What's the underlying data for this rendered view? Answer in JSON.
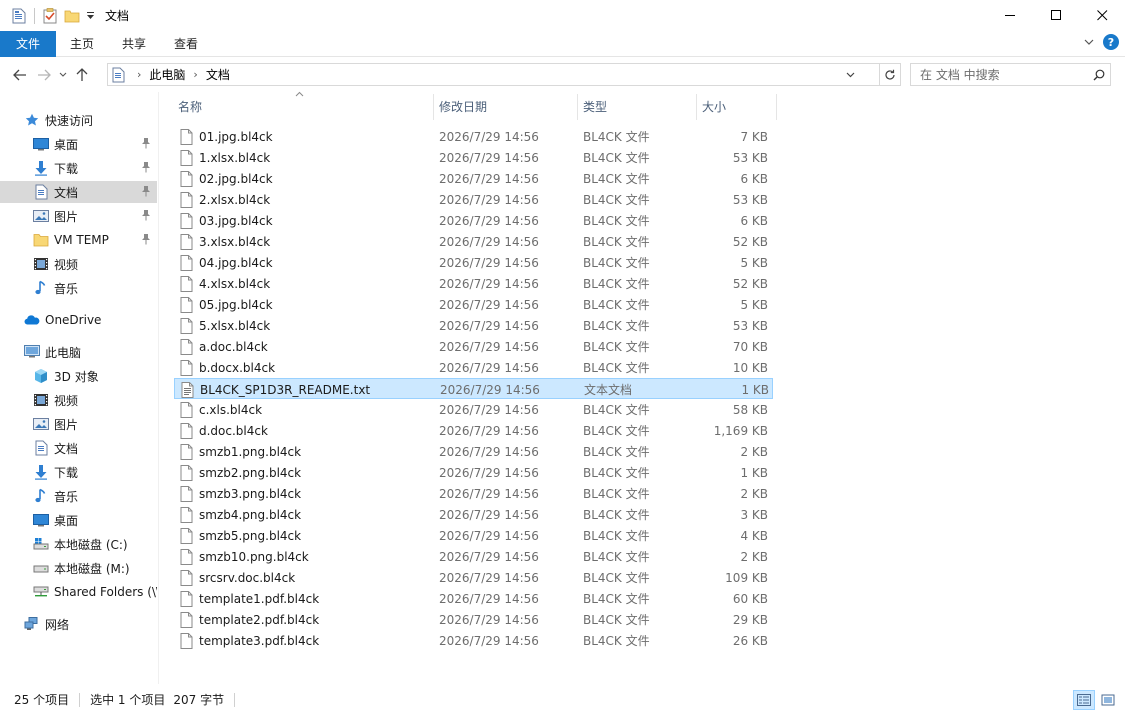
{
  "window": {
    "title": "文档"
  },
  "ribbon": {
    "tabs": [
      "文件",
      "主页",
      "共享",
      "查看"
    ]
  },
  "address": {
    "crumbs": [
      "此电脑",
      "文档"
    ]
  },
  "search": {
    "placeholder": "在 文档 中搜索"
  },
  "sidebar": {
    "quick_access": "快速访问",
    "qa_items": [
      {
        "label": "桌面",
        "icon": "desktop-icon"
      },
      {
        "label": "下载",
        "icon": "download-icon"
      },
      {
        "label": "文档",
        "icon": "document-icon"
      },
      {
        "label": "图片",
        "icon": "pictures-icon"
      },
      {
        "label": "VM TEMP",
        "icon": "folder-icon"
      },
      {
        "label": "视频",
        "icon": "video-icon"
      },
      {
        "label": "音乐",
        "icon": "music-icon"
      }
    ],
    "onedrive": "OneDrive",
    "this_pc": "此电脑",
    "pc_items": [
      {
        "label": "3D 对象",
        "icon": "3d-objects-icon"
      },
      {
        "label": "视频",
        "icon": "video-icon"
      },
      {
        "label": "图片",
        "icon": "pictures-icon"
      },
      {
        "label": "文档",
        "icon": "document-icon"
      },
      {
        "label": "下载",
        "icon": "download-icon"
      },
      {
        "label": "音乐",
        "icon": "music-icon"
      },
      {
        "label": "桌面",
        "icon": "desktop-icon"
      },
      {
        "label": "本地磁盘 (C:)",
        "icon": "drive-c-icon"
      },
      {
        "label": "本地磁盘 (M:)",
        "icon": "drive-icon"
      },
      {
        "label": "Shared Folders (\\\\",
        "icon": "network-drive-icon"
      }
    ],
    "network": "网络"
  },
  "columns": {
    "name": "名称",
    "date": "修改日期",
    "type": "类型",
    "size": "大小"
  },
  "files": [
    {
      "name": "01.jpg.bl4ck",
      "date": "2026/7/29 14:56",
      "type": "BL4CK 文件",
      "size": "7 KB"
    },
    {
      "name": "1.xlsx.bl4ck",
      "date": "2026/7/29 14:56",
      "type": "BL4CK 文件",
      "size": "53 KB"
    },
    {
      "name": "02.jpg.bl4ck",
      "date": "2026/7/29 14:56",
      "type": "BL4CK 文件",
      "size": "6 KB"
    },
    {
      "name": "2.xlsx.bl4ck",
      "date": "2026/7/29 14:56",
      "type": "BL4CK 文件",
      "size": "53 KB"
    },
    {
      "name": "03.jpg.bl4ck",
      "date": "2026/7/29 14:56",
      "type": "BL4CK 文件",
      "size": "6 KB"
    },
    {
      "name": "3.xlsx.bl4ck",
      "date": "2026/7/29 14:56",
      "type": "BL4CK 文件",
      "size": "52 KB"
    },
    {
      "name": "04.jpg.bl4ck",
      "date": "2026/7/29 14:56",
      "type": "BL4CK 文件",
      "size": "5 KB"
    },
    {
      "name": "4.xlsx.bl4ck",
      "date": "2026/7/29 14:56",
      "type": "BL4CK 文件",
      "size": "52 KB"
    },
    {
      "name": "05.jpg.bl4ck",
      "date": "2026/7/29 14:56",
      "type": "BL4CK 文件",
      "size": "5 KB"
    },
    {
      "name": "5.xlsx.bl4ck",
      "date": "2026/7/29 14:56",
      "type": "BL4CK 文件",
      "size": "53 KB"
    },
    {
      "name": "a.doc.bl4ck",
      "date": "2026/7/29 14:56",
      "type": "BL4CK 文件",
      "size": "70 KB"
    },
    {
      "name": "b.docx.bl4ck",
      "date": "2026/7/29 14:56",
      "type": "BL4CK 文件",
      "size": "10 KB"
    },
    {
      "name": "BL4CK_SP1D3R_README.txt",
      "date": "2026/7/29 14:56",
      "type": "文本文档",
      "size": "1 KB",
      "selected": true
    },
    {
      "name": "c.xls.bl4ck",
      "date": "2026/7/29 14:56",
      "type": "BL4CK 文件",
      "size": "58 KB"
    },
    {
      "name": "d.doc.bl4ck",
      "date": "2026/7/29 14:56",
      "type": "BL4CK 文件",
      "size": "1,169 KB"
    },
    {
      "name": "smzb1.png.bl4ck",
      "date": "2026/7/29 14:56",
      "type": "BL4CK 文件",
      "size": "2 KB"
    },
    {
      "name": "smzb2.png.bl4ck",
      "date": "2026/7/29 14:56",
      "type": "BL4CK 文件",
      "size": "1 KB"
    },
    {
      "name": "smzb3.png.bl4ck",
      "date": "2026/7/29 14:56",
      "type": "BL4CK 文件",
      "size": "2 KB"
    },
    {
      "name": "smzb4.png.bl4ck",
      "date": "2026/7/29 14:56",
      "type": "BL4CK 文件",
      "size": "3 KB"
    },
    {
      "name": "smzb5.png.bl4ck",
      "date": "2026/7/29 14:56",
      "type": "BL4CK 文件",
      "size": "4 KB"
    },
    {
      "name": "smzb10.png.bl4ck",
      "date": "2026/7/29 14:56",
      "type": "BL4CK 文件",
      "size": "2 KB"
    },
    {
      "name": "srcsrv.doc.bl4ck",
      "date": "2026/7/29 14:56",
      "type": "BL4CK 文件",
      "size": "109 KB"
    },
    {
      "name": "template1.pdf.bl4ck",
      "date": "2026/7/29 14:56",
      "type": "BL4CK 文件",
      "size": "60 KB"
    },
    {
      "name": "template2.pdf.bl4ck",
      "date": "2026/7/29 14:56",
      "type": "BL4CK 文件",
      "size": "29 KB"
    },
    {
      "name": "template3.pdf.bl4ck",
      "date": "2026/7/29 14:56",
      "type": "BL4CK 文件",
      "size": "26 KB"
    }
  ],
  "status": {
    "count": "25 个项目",
    "selection": "选中 1 个项目",
    "bytes": "207 字节"
  },
  "colors": {
    "accent": "#1979ca",
    "selection_bg": "#cce8ff",
    "selection_border": "#99d1ff",
    "header_text": "#4c607a",
    "secondary_text": "#6d6d6d"
  }
}
